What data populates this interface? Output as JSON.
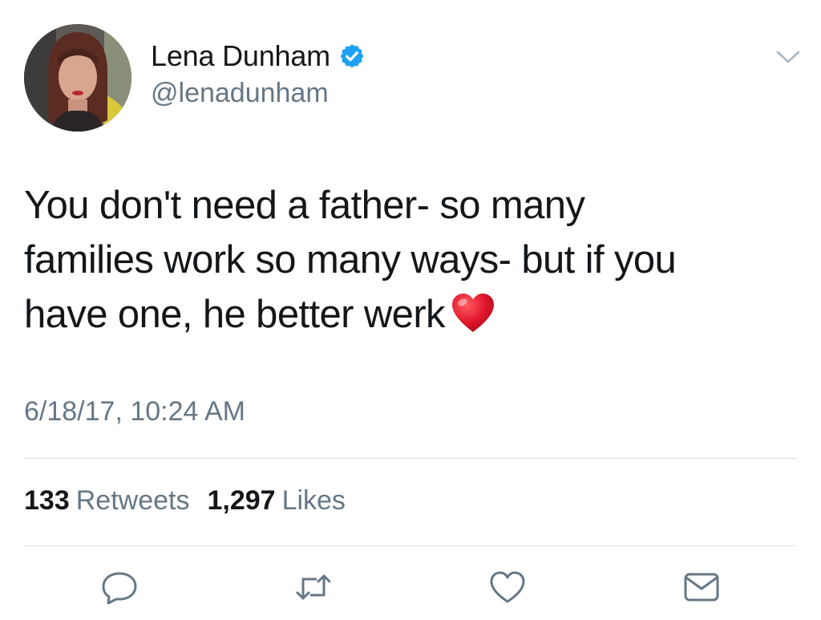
{
  "author": {
    "display_name": "Lena Dunham",
    "handle": "@lenadunham",
    "verified": true
  },
  "tweet": {
    "lines": [
      "You don't need a father- so many",
      "families work so many ways- but if you",
      "have one, he better werk"
    ],
    "emoji": "red-heart",
    "timestamp": "6/18/17, 10:24 AM"
  },
  "stats": {
    "retweets_count": "133",
    "retweets_label": "Retweets",
    "likes_count": "1,297",
    "likes_label": "Likes"
  },
  "colors": {
    "text": "#14171a",
    "secondary": "#657786",
    "verified_blue": "#1da1f2",
    "divider": "#d8dee3",
    "heart_red": "#e0162b"
  },
  "actions": [
    "reply-icon",
    "retweet-icon",
    "like-icon",
    "direct-message-icon"
  ]
}
